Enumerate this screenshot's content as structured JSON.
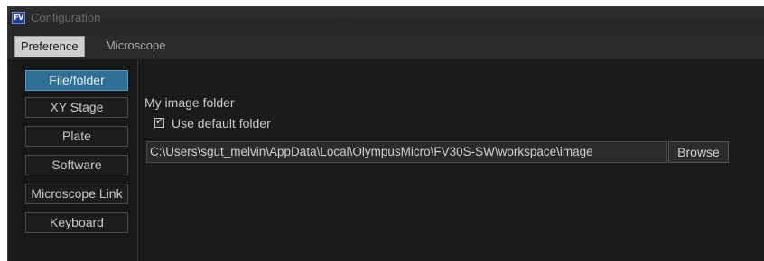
{
  "window": {
    "title": "Configuration",
    "logo_text": "FV"
  },
  "tabs": [
    {
      "label": "Preference",
      "active": true
    },
    {
      "label": "Microscope",
      "active": false
    }
  ],
  "sidebar": {
    "items": [
      {
        "label": "File/folder",
        "selected": true
      },
      {
        "label": "XY Stage",
        "selected": false
      },
      {
        "label": "Plate",
        "selected": false
      },
      {
        "label": "Software",
        "selected": false
      },
      {
        "label": "Microscope Link",
        "selected": false
      },
      {
        "label": "Keyboard",
        "selected": false
      }
    ]
  },
  "image_folder": {
    "section_label": "My image folder",
    "use_default_label": "Use default folder",
    "use_default_checked": true,
    "path_value": "C:\\Users\\sgut_melvin\\AppData\\Local\\OlympusMicro\\FV30S-SW\\workspace\\image",
    "browse_label": "Browse"
  },
  "colors": {
    "selected_accent": "#2e6f93",
    "background": "#1b1b1b"
  },
  "icons": {
    "app": "fv-logo-icon",
    "checkbox": "checkmark-icon"
  }
}
